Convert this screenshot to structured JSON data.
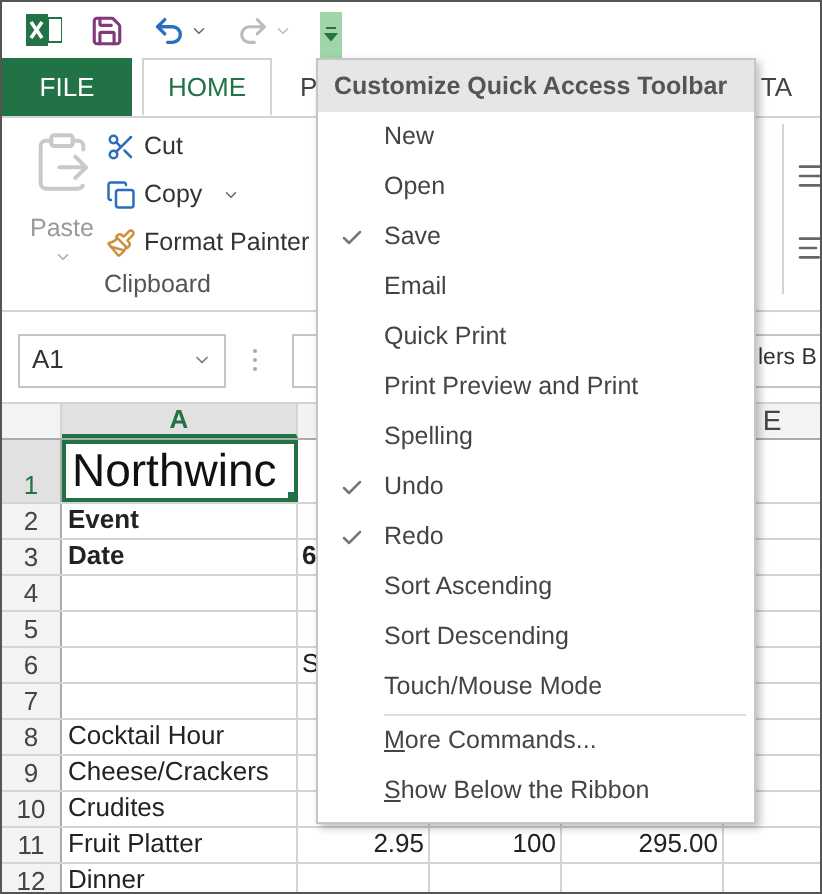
{
  "ribbon": {
    "tabs": [
      {
        "label": "FILE",
        "kind": "file",
        "selected": false
      },
      {
        "label": "HOME",
        "kind": "tab",
        "selected": true
      },
      {
        "label": "P",
        "kind": "tab",
        "selected": false
      },
      {
        "label": "TA",
        "kind": "tab",
        "selected": false
      }
    ],
    "clipboard": {
      "paste": "Paste",
      "commands": [
        "Cut",
        "Copy",
        "Format Painter"
      ],
      "group": "Clipboard"
    }
  },
  "name_box": "A1",
  "formula": "lers B",
  "column_headers": {
    "first": {
      "label": "A",
      "selected": true
    },
    "last": {
      "label": "E",
      "selected": false
    }
  },
  "rows": [
    {
      "number": "1",
      "selected": true,
      "bold": false,
      "a": "Northwinc"
    },
    {
      "number": "2",
      "selected": false,
      "bold": true,
      "a": "Event"
    },
    {
      "number": "3",
      "selected": false,
      "bold": true,
      "a": "Date",
      "b": "6"
    },
    {
      "number": "4",
      "selected": false
    },
    {
      "number": "5",
      "selected": false
    },
    {
      "number": "6",
      "selected": false,
      "bold": false,
      "b": "S"
    },
    {
      "number": "7",
      "selected": false
    },
    {
      "number": "8",
      "selected": false,
      "bold": false,
      "a": "Cocktail Hour"
    },
    {
      "number": "9",
      "selected": false,
      "bold": false,
      "a": "Cheese/Crackers"
    },
    {
      "number": "10",
      "selected": false,
      "bold": false,
      "a": "Crudites"
    },
    {
      "number": "11",
      "selected": false,
      "bold": false,
      "a": "Fruit Platter",
      "b": "2.95",
      "c": "100",
      "d": "295.00"
    },
    {
      "number": "12",
      "selected": false,
      "bold": false,
      "a": "Dinner"
    }
  ],
  "menu": {
    "title": "Customize Quick Access Toolbar",
    "items": [
      {
        "label": "New",
        "checked": false
      },
      {
        "label": "Open",
        "checked": false
      },
      {
        "label": "Save",
        "checked": true
      },
      {
        "label": "Email",
        "checked": false
      },
      {
        "label": "Quick Print",
        "checked": false
      },
      {
        "label": "Print Preview and Print",
        "checked": false
      },
      {
        "label": "Spelling",
        "checked": false
      },
      {
        "label": "Undo",
        "checked": true
      },
      {
        "label": "Redo",
        "checked": true
      },
      {
        "label": "Sort Ascending",
        "checked": false
      },
      {
        "label": "Sort Descending",
        "checked": false
      },
      {
        "label": "Touch/Mouse Mode",
        "checked": false
      },
      {
        "label": "More Commands...",
        "checked": false,
        "separator_before": true,
        "underline_first": true
      },
      {
        "label": "Show Below the Ribbon",
        "checked": false,
        "underline_first": true
      }
    ]
  }
}
